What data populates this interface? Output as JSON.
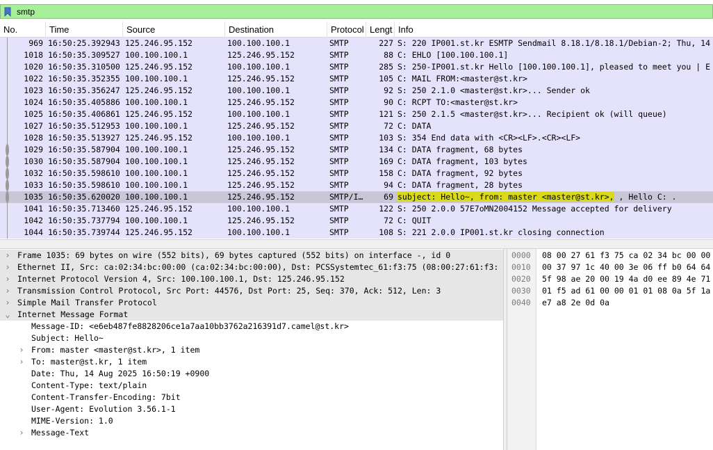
{
  "filter": {
    "value": "smtp",
    "icon": "bookmark-icon"
  },
  "columns": [
    "No.",
    "Time",
    "Source",
    "Destination",
    "Protocol",
    "Lengt",
    "Info"
  ],
  "packets": [
    {
      "no": "969",
      "time": "16:50:25.392943",
      "src": "125.246.95.152",
      "dst": "100.100.100.1",
      "proto": "SMTP",
      "len": "227",
      "info": "S: 220 IP001.st.kr ESMTP Sendmail 8.18.1/8.18.1/Debian-2; Thu, 14"
    },
    {
      "no": "1018",
      "time": "16:50:35.309527",
      "src": "100.100.100.1",
      "dst": "125.246.95.152",
      "proto": "SMTP",
      "len": "88",
      "info": "C: EHLO [100.100.100.1]"
    },
    {
      "no": "1020",
      "time": "16:50:35.310500",
      "src": "125.246.95.152",
      "dst": "100.100.100.1",
      "proto": "SMTP",
      "len": "285",
      "info": "S: 250-IP001.st.kr Hello [100.100.100.1], pleased to meet you | E"
    },
    {
      "no": "1022",
      "time": "16:50:35.352355",
      "src": "100.100.100.1",
      "dst": "125.246.95.152",
      "proto": "SMTP",
      "len": "105",
      "info": "C: MAIL FROM:<master@st.kr>"
    },
    {
      "no": "1023",
      "time": "16:50:35.356247",
      "src": "125.246.95.152",
      "dst": "100.100.100.1",
      "proto": "SMTP",
      "len": "92",
      "info": "S: 250 2.1.0 <master@st.kr>... Sender ok"
    },
    {
      "no": "1024",
      "time": "16:50:35.405886",
      "src": "100.100.100.1",
      "dst": "125.246.95.152",
      "proto": "SMTP",
      "len": "90",
      "info": "C: RCPT TO:<master@st.kr>"
    },
    {
      "no": "1025",
      "time": "16:50:35.406861",
      "src": "125.246.95.152",
      "dst": "100.100.100.1",
      "proto": "SMTP",
      "len": "121",
      "info": "S: 250 2.1.5 <master@st.kr>... Recipient ok (will queue)"
    },
    {
      "no": "1027",
      "time": "16:50:35.512953",
      "src": "100.100.100.1",
      "dst": "125.246.95.152",
      "proto": "SMTP",
      "len": "72",
      "info": "C: DATA"
    },
    {
      "no": "1028",
      "time": "16:50:35.513927",
      "src": "125.246.95.152",
      "dst": "100.100.100.1",
      "proto": "SMTP",
      "len": "103",
      "info": "S: 354 End data with <CR><LF>.<CR><LF>"
    },
    {
      "no": "1029",
      "time": "16:50:35.587904",
      "src": "100.100.100.1",
      "dst": "125.246.95.152",
      "proto": "SMTP",
      "len": "134",
      "info": "C: DATA fragment, 68 bytes"
    },
    {
      "no": "1030",
      "time": "16:50:35.587904",
      "src": "100.100.100.1",
      "dst": "125.246.95.152",
      "proto": "SMTP",
      "len": "169",
      "info": "C: DATA fragment, 103 bytes"
    },
    {
      "no": "1032",
      "time": "16:50:35.598610",
      "src": "100.100.100.1",
      "dst": "125.246.95.152",
      "proto": "SMTP",
      "len": "158",
      "info": "C: DATA fragment, 92 bytes"
    },
    {
      "no": "1033",
      "time": "16:50:35.598610",
      "src": "100.100.100.1",
      "dst": "125.246.95.152",
      "proto": "SMTP",
      "len": "94",
      "info": "C: DATA fragment, 28 bytes"
    },
    {
      "no": "1035",
      "time": "16:50:35.620020",
      "src": "100.100.100.1",
      "dst": "125.246.95.152",
      "proto": "SMTP/I…",
      "len": "69",
      "info_highlight": "subject: Hello~, from: master <master@st.kr>,",
      "info_rest": " , Hello  C: ."
    },
    {
      "no": "1041",
      "time": "16:50:35.713460",
      "src": "125.246.95.152",
      "dst": "100.100.100.1",
      "proto": "SMTP",
      "len": "122",
      "info": "S: 250 2.0.0 57E7oMN2004152 Message accepted for delivery"
    },
    {
      "no": "1042",
      "time": "16:50:35.737794",
      "src": "100.100.100.1",
      "dst": "125.246.95.152",
      "proto": "SMTP",
      "len": "72",
      "info": "C: QUIT"
    },
    {
      "no": "1044",
      "time": "16:50:35.739744",
      "src": "125.246.95.152",
      "dst": "100.100.100.1",
      "proto": "SMTP",
      "len": "108",
      "info": "S: 221 2.0.0 IP001.st.kr closing connection"
    }
  ],
  "details": [
    {
      "text": "Frame 1035: 69 bytes on wire (552 bits), 69 bytes captured (552 bits) on interface -, id 0",
      "arrow": "›"
    },
    {
      "text": "Ethernet II, Src: ca:02:34:bc:00:00 (ca:02:34:bc:00:00), Dst: PCSSystemtec_61:f3:75 (08:00:27:61:f3:",
      "arrow": "›"
    },
    {
      "text": "Internet Protocol Version 4, Src: 100.100.100.1, Dst: 125.246.95.152",
      "arrow": "›"
    },
    {
      "text": "Transmission Control Protocol, Src Port: 44576, Dst Port: 25, Seq: 370, Ack: 512, Len: 3",
      "arrow": "›"
    },
    {
      "text": "Simple Mail Transfer Protocol",
      "arrow": "›"
    },
    {
      "text": "Internet Message Format",
      "arrow": "⌄"
    },
    {
      "text": "Message-ID: <e6eb487fe8828206ce1a7aa10bb3762a216391d7.camel@st.kr>",
      "arrow": ""
    },
    {
      "text": "Subject: Hello~",
      "arrow": ""
    },
    {
      "text": "From: master <master@st.kr>, 1 item",
      "arrow": "›"
    },
    {
      "text": "To: master@st.kr, 1 item",
      "arrow": "›"
    },
    {
      "text": "Date: Thu, 14 Aug 2025 16:50:19 +0900",
      "arrow": ""
    },
    {
      "text": "Content-Type: text/plain",
      "arrow": ""
    },
    {
      "text": "Content-Transfer-Encoding: 7bit",
      "arrow": ""
    },
    {
      "text": "User-Agent: Evolution 3.56.1-1",
      "arrow": ""
    },
    {
      "text": "MIME-Version: 1.0",
      "arrow": ""
    },
    {
      "text": "Message-Text",
      "arrow": "›"
    }
  ],
  "bytes": [
    {
      "offset": "0000",
      "hex": "08 00 27 61 f3 75 ca 02  34 bc 00 00"
    },
    {
      "offset": "0010",
      "hex": "00 37 97 1c 40 00 3e 06  ff b0 64 64"
    },
    {
      "offset": "0020",
      "hex": "5f 98 ae 20 00 19 4a d0  ee 89 4e 71"
    },
    {
      "offset": "0030",
      "hex": "01 f5 ad 61 00 00 01 01  08 0a 5f 1a"
    },
    {
      "offset": "0040",
      "hex": "e7 a8 2e 0d 0a"
    }
  ]
}
